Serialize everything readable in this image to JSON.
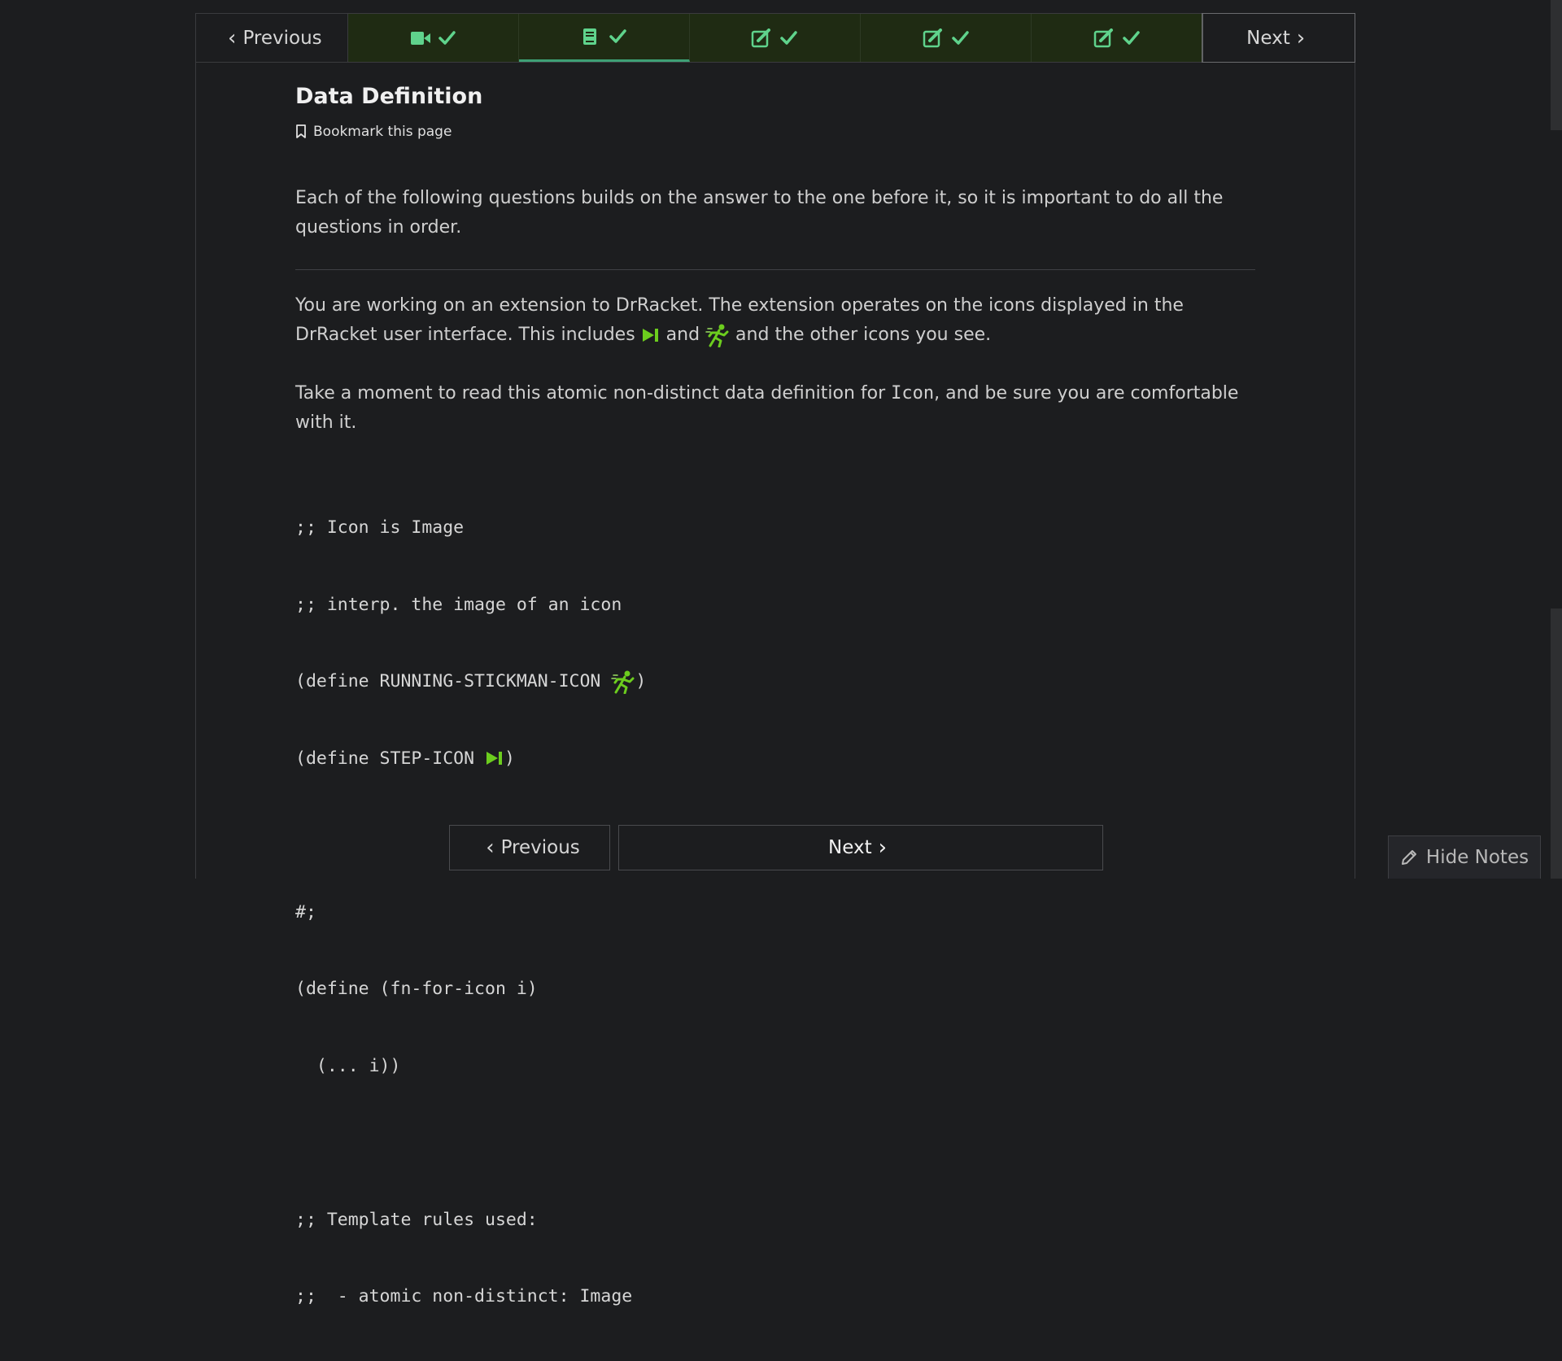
{
  "nav": {
    "previous_label": "Previous",
    "next_label": "Next",
    "units": [
      {
        "icon": "video-icon",
        "status": "check-icon"
      },
      {
        "icon": "book-icon",
        "status": "check-icon",
        "active": true
      },
      {
        "icon": "edit-icon",
        "status": "check-icon"
      },
      {
        "icon": "edit-icon",
        "status": "check-icon"
      },
      {
        "icon": "edit-icon",
        "status": "check-icon"
      }
    ]
  },
  "page": {
    "title": "Data Definition",
    "bookmark_label": "Bookmark this page"
  },
  "content": {
    "intro": "Each of the following questions builds on the answer to the one before it, so it is important to do all the questions in order.",
    "p2_part1": "You are working on an extension to DrRacket. The extension operates on the icons displayed in the DrRacket user interface. This includes ",
    "p2_part2": " and ",
    "p2_part3": " and the other icons you see.",
    "p3_part1": "Take a moment to read this atomic non-distinct data definition for ",
    "p3_code": "Icon",
    "p3_part2": ", and be sure you are comfortable with it.",
    "code": {
      "l1": ";; Icon is Image",
      "l2": ";; interp. the image of an icon",
      "l3_pre": "(define RUNNING-STICKMAN-ICON ",
      "l3_post": ")",
      "l4_pre": "(define STEP-ICON ",
      "l4_post": ")",
      "l5": "#;",
      "l6": "(define (fn-for-icon i)",
      "l7": "  (... i))",
      "l8": ";; Template rules used:",
      "l9": ";;  - atomic non-distinct: Image"
    }
  },
  "bottom_nav": {
    "previous_label": "Previous",
    "next_label": "Next"
  },
  "notes": {
    "hide_label": "Hide Notes"
  },
  "colors": {
    "background": "#1c1d1f",
    "unit_bg": "#1f2b13",
    "check": "#5fd38c",
    "step_icon": "#6ccd1e",
    "active_underline": "#3ea076"
  }
}
